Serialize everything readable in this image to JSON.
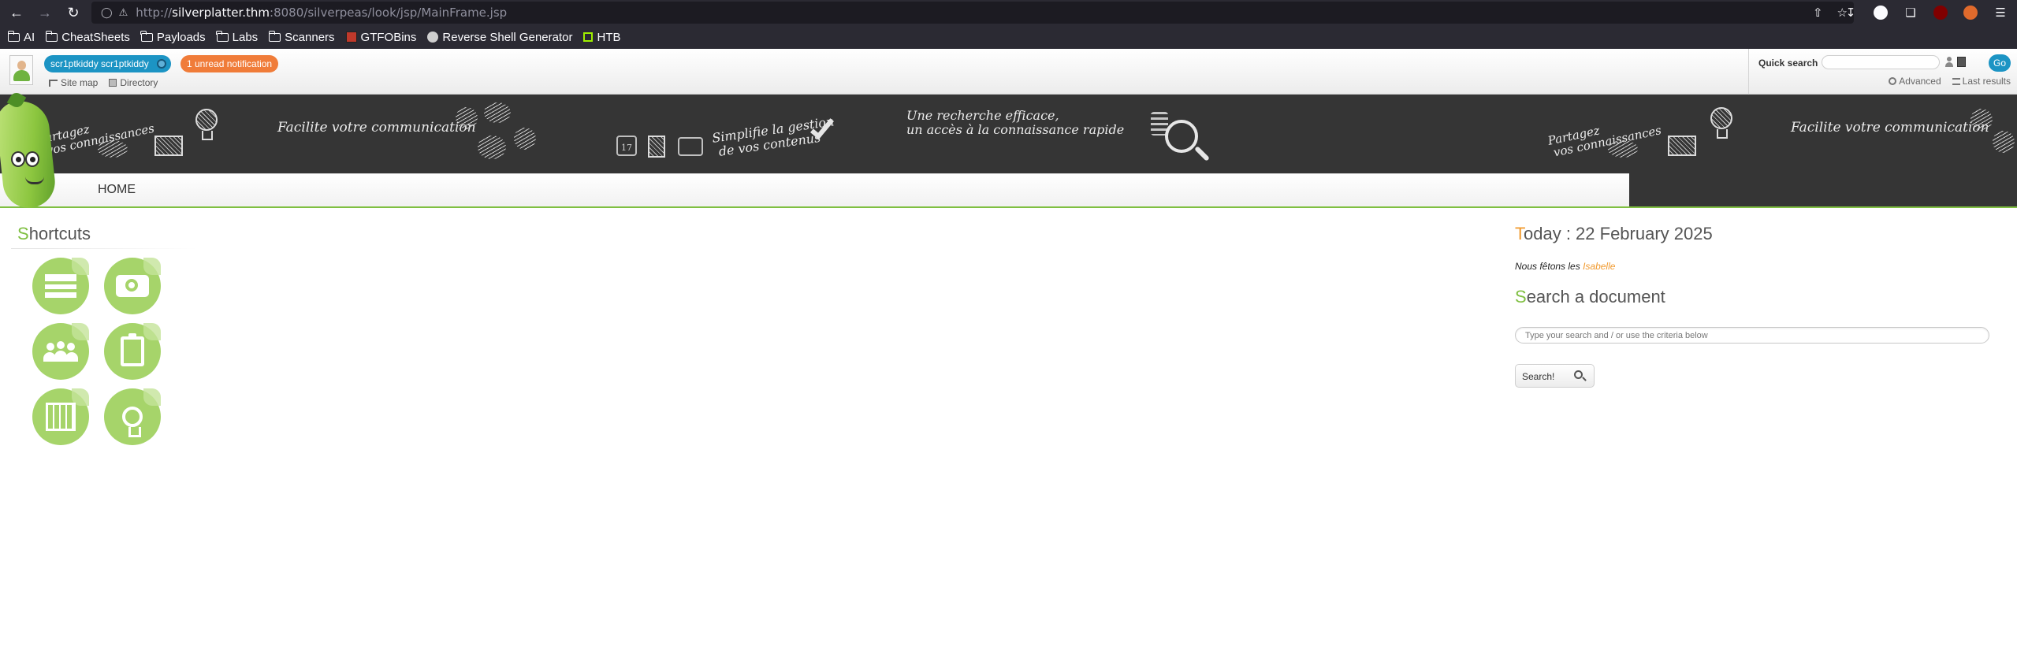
{
  "browser": {
    "url_prefix": "http://",
    "url_host": "silverplatter.thm",
    "url_rest": ":8080/silverpeas/look/jsp/MainFrame.jsp",
    "bookmarks": [
      {
        "label": "AI",
        "icon": "folder-icon"
      },
      {
        "label": "CheatSheets",
        "icon": "folder-icon"
      },
      {
        "label": "Payloads",
        "icon": "folder-icon"
      },
      {
        "label": "Labs",
        "icon": "folder-icon"
      },
      {
        "label": "Scanners",
        "icon": "folder-icon"
      },
      {
        "label": "GTFOBins",
        "icon": "gtfobins-icon"
      },
      {
        "label": "Reverse Shell Generator",
        "icon": "skull-icon"
      },
      {
        "label": "HTB",
        "icon": "htb-cube-icon"
      }
    ]
  },
  "topbar": {
    "user_name": "scr1ptkiddy scr1ptkiddy",
    "notification": "1 unread notification",
    "site_map": "Site map",
    "directory": "Directory",
    "quick_search_label": "Quick search",
    "go_label": "Go",
    "advanced": "Advanced",
    "last_results": "Last results"
  },
  "banner": {
    "partagez": "Partagez",
    "connaissances": "vos connaissances",
    "facilite": "Facilite votre communication",
    "simplifie_1": "Simplifie la gestion",
    "simplifie_2": "de vos contenus",
    "recherche_1": "Une recherche efficace,",
    "recherche_2": "un accès à la connaissance rapide",
    "partagez_2": "Partagez",
    "connaissances_2": "vos connaissances",
    "facilite_2": "Facilite votre communication",
    "calendar_day": "17"
  },
  "menu": {
    "home": "HOME"
  },
  "shortcuts": {
    "title_first": "S",
    "title_rest": "hortcuts",
    "items": [
      {
        "icon": "books-icon"
      },
      {
        "icon": "camera-icon"
      },
      {
        "icon": "community-icon"
      },
      {
        "icon": "clipboard-icon"
      },
      {
        "icon": "calendar-icon"
      },
      {
        "icon": "lightbulb-icon"
      }
    ]
  },
  "today": {
    "title_first": "T",
    "title_rest": "oday : 22 February 2025",
    "feast_prefix": "Nous fêtons les",
    "feast_name": "Isabelle"
  },
  "search_doc": {
    "title_first": "S",
    "title_rest": "earch a document",
    "placeholder": "Type your search and / or use the criteria below",
    "button": "Search!"
  },
  "colors": {
    "accent_green": "#7fbf41",
    "accent_orange": "#f19a2e",
    "user_pill_blue": "#1c94c4",
    "notification_orange": "#f07c39",
    "banner_dark": "#353535"
  }
}
